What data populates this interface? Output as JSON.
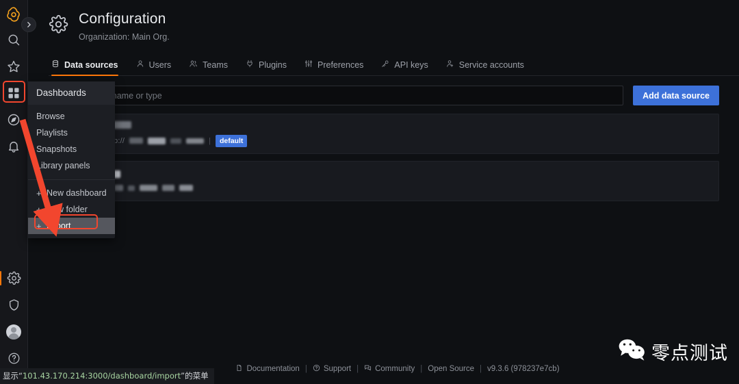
{
  "app": {
    "brand": "Grafana",
    "accent_orange": "#ff780a",
    "accent_blue": "#3d71d9",
    "annotation_red": "#f2462e"
  },
  "sidebar": {
    "top_items": [
      {
        "name": "grafana-logo",
        "label": "Grafana"
      },
      {
        "name": "search",
        "label": "Search"
      },
      {
        "name": "starred",
        "label": "Starred"
      },
      {
        "name": "dashboards",
        "label": "Dashboards"
      },
      {
        "name": "explore",
        "label": "Explore"
      },
      {
        "name": "alerting",
        "label": "Alerting"
      }
    ],
    "bottom_items": [
      {
        "name": "configuration",
        "label": "Configuration"
      },
      {
        "name": "server-admin",
        "label": "Server Admin"
      },
      {
        "name": "profile",
        "label": "Profile"
      },
      {
        "name": "help",
        "label": "Help"
      }
    ],
    "expand_label": "Expand section"
  },
  "header": {
    "title": "Configuration",
    "subtitle": "Organization: Main Org.",
    "icon": "gear-icon"
  },
  "tabs": [
    {
      "label": "Data sources",
      "icon": "database-icon",
      "active": true
    },
    {
      "label": "Users",
      "icon": "user-icon",
      "active": false
    },
    {
      "label": "Teams",
      "icon": "users-icon",
      "active": false
    },
    {
      "label": "Plugins",
      "icon": "plug-icon",
      "active": false
    },
    {
      "label": "Preferences",
      "icon": "sliders-icon",
      "active": false
    },
    {
      "label": "API keys",
      "icon": "key-icon",
      "active": false
    },
    {
      "label": "Service accounts",
      "icon": "service-account-icon",
      "active": false
    }
  ],
  "toolbar": {
    "search_placeholder": "Search by name or type",
    "search_value": "",
    "add_button": "Add data source"
  },
  "datasources": [
    {
      "name_redacted": true,
      "url_prefix": "http://",
      "url_redacted": true,
      "port_label": "3",
      "badge": "default"
    },
    {
      "name_redacted": true,
      "url_prefix": "",
      "url_redacted": true,
      "badge": ""
    }
  ],
  "menu": {
    "header": "Dashboards",
    "items": [
      {
        "label": "Browse",
        "plus": false,
        "hovered": false
      },
      {
        "label": "Playlists",
        "plus": false,
        "hovered": false
      },
      {
        "label": "Snapshots",
        "plus": false,
        "hovered": false
      },
      {
        "label": "Library panels",
        "plus": false,
        "hovered": false
      }
    ],
    "create_items": [
      {
        "label": "New dashboard",
        "plus": true,
        "hovered": false
      },
      {
        "label": "New folder",
        "plus": true,
        "hovered": false
      },
      {
        "label": "Import",
        "plus": true,
        "hovered": true
      }
    ],
    "plus_glyph": "+"
  },
  "footer": {
    "documentation": "Documentation",
    "support": "Support",
    "community": "Community",
    "open_source": "Open Source",
    "version": "v9.3.6 (978237e7cb)",
    "separator": "|"
  },
  "watermark": {
    "text": "零点测试",
    "icon": "wechat-icon"
  },
  "statusbar": {
    "prefix": "显示“",
    "url": "101.43.170.214:3000/dashboard/import",
    "suffix": "”的菜单"
  }
}
